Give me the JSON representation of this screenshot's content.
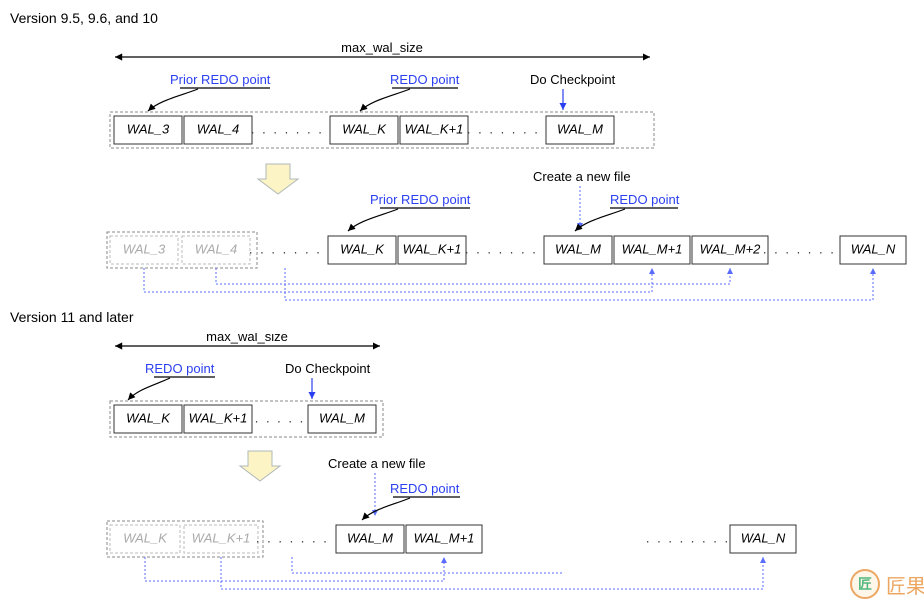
{
  "section1": {
    "title": "Version 9.5, 9.6, and 10",
    "max_wal_size": "max_wal_size",
    "labels": {
      "prior_redo": "Prior REDO point",
      "redo": "REDO point",
      "do_checkpoint": "Do Checkpoint",
      "create_new": "Create a new file"
    },
    "row1": {
      "cells": [
        "WAL_3",
        "WAL_4",
        "WAL_K",
        "WAL_K+1",
        "WAL_M"
      ]
    },
    "row2": {
      "ghost": [
        "WAL_3",
        "WAL_4"
      ],
      "cells": [
        "WAL_K",
        "WAL_K+1",
        "WAL_M",
        "WAL_M+1",
        "WAL_M+2",
        "WAL_N"
      ]
    }
  },
  "section2": {
    "title": "Version 11 and later",
    "max_wal_size": "max_wal_size",
    "labels": {
      "redo": "REDO point",
      "do_checkpoint": "Do Checkpoint",
      "create_new": "Create a new file"
    },
    "row1": {
      "cells": [
        "WAL_K",
        "WAL_K+1",
        "WAL_M"
      ]
    },
    "row2": {
      "ghost": [
        "WAL_K",
        "WAL_K+1"
      ],
      "cells": [
        "WAL_M",
        "WAL_M+1",
        "WAL_N"
      ]
    }
  },
  "watermark": "匠果"
}
